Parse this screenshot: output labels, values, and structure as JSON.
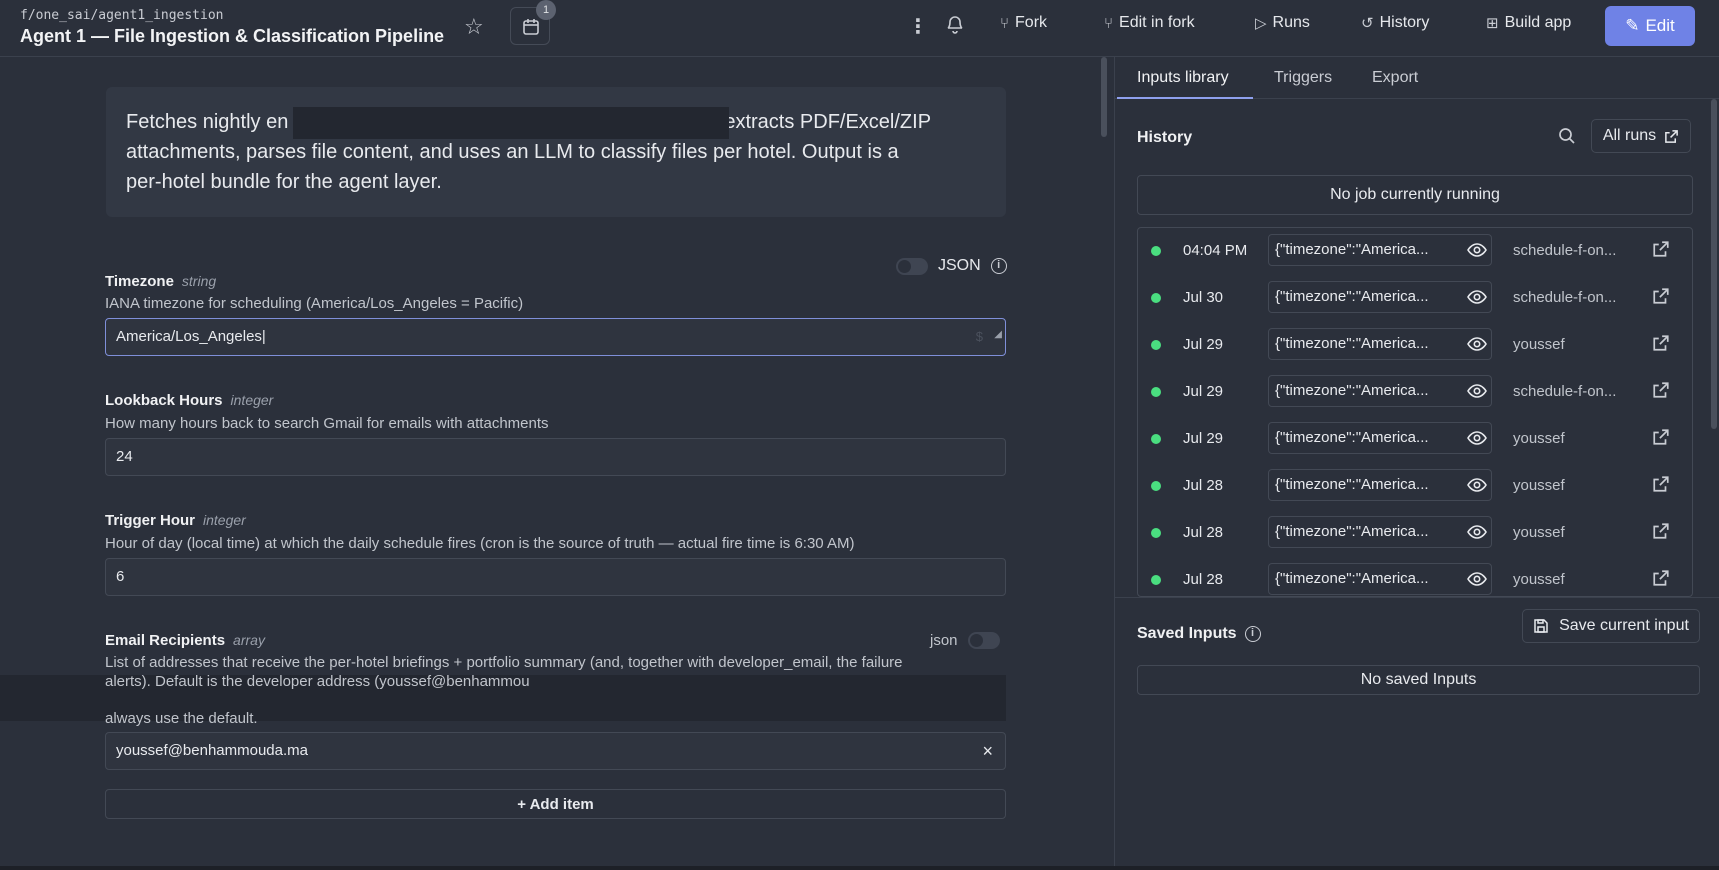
{
  "header": {
    "path": "f/one_sai/agent1_ingestion",
    "title": "Agent 1 — File Ingestion & Classification Pipeline",
    "schedule_badge": "1",
    "fork_label": "Fork",
    "edit_in_fork_label": "Edit in fork",
    "runs_label": "Runs",
    "history_label": "History",
    "build_app_label": "Build app",
    "edit_label": "Edit"
  },
  "description": {
    "line1_start": "Fetches nightly en",
    "line1_end": "extracts PDF/Excel/ZIP",
    "line2": "attachments, parses file content, and uses an LLM to classify files per hotel. Output is a",
    "line3": "per-hotel bundle for the agent layer."
  },
  "json_toggle_label": "JSON",
  "fields": {
    "timezone": {
      "label": "Timezone",
      "type": "string",
      "description": "IANA timezone for scheduling (America/Los_Angeles = Pacific)",
      "value": "America/Los_Angeles",
      "suffix": "$"
    },
    "lookback": {
      "label": "Lookback Hours",
      "type": "integer",
      "description": "How many hours back to search Gmail for emails with attachments",
      "value": "24"
    },
    "trigger": {
      "label": "Trigger Hour",
      "type": "integer",
      "description": "Hour of day (local time) at which the daily schedule fires (cron is the source of truth — actual fire time is 6:30 AM)",
      "value": "6"
    },
    "recipients": {
      "label": "Email Recipients",
      "type": "array",
      "json_label": "json",
      "description_line1": "List of addresses that receive the per-hotel briefings + portfolio summary (and, together with developer_email, the failure",
      "description_line2": "alerts). Default is the developer address (youssef@benhammou",
      "description_line3": "always use the default.",
      "item_value": "youssef@benhammouda.ma",
      "clear_icon": "×",
      "add_item_label": "+ Add item"
    }
  },
  "right_panel": {
    "tabs": [
      "Inputs library",
      "Triggers",
      "Export"
    ],
    "history_title": "History",
    "all_runs_label": "All runs",
    "no_job_text": "No job currently running",
    "runs": [
      {
        "time": "04:04 PM",
        "args": "{\"timezone\":\"America...",
        "user": "schedule-f-on..."
      },
      {
        "time": "Jul 30",
        "args": "{\"timezone\":\"America...",
        "user": "schedule-f-on..."
      },
      {
        "time": "Jul 29",
        "args": "{\"timezone\":\"America...",
        "user": "youssef"
      },
      {
        "time": "Jul 29",
        "args": "{\"timezone\":\"America...",
        "user": "schedule-f-on..."
      },
      {
        "time": "Jul 29",
        "args": "{\"timezone\":\"America...",
        "user": "youssef"
      },
      {
        "time": "Jul 28",
        "args": "{\"timezone\":\"America...",
        "user": "youssef"
      },
      {
        "time": "Jul 28",
        "args": "{\"timezone\":\"America...",
        "user": "youssef"
      },
      {
        "time": "Jul 28",
        "args": "{\"timezone\":\"America...",
        "user": "youssef"
      }
    ],
    "saved_inputs_title": "Saved Inputs",
    "save_current_label": "Save current input",
    "no_saved_text": "No saved Inputs"
  },
  "colors": {
    "accent": "#6f82e6",
    "success": "#4ade80",
    "background": "#2b303b"
  }
}
